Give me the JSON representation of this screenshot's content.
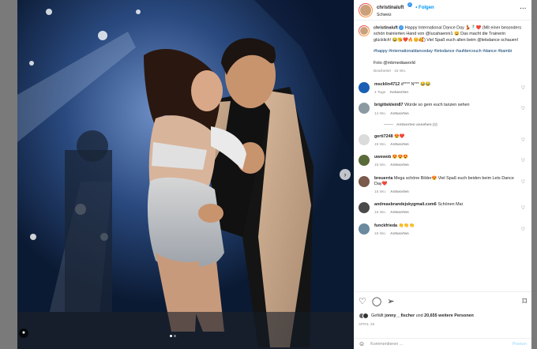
{
  "post": {
    "username": "christinaluft",
    "follow_label": "Folgen",
    "location": "Schweiz",
    "more_icon": "more-horizontal-icon",
    "carousel_dots": 2,
    "carousel_active": 1
  },
  "caption": {
    "username": "christinaluft",
    "text": "Happy International Dance Day 💃🕺❤️ (Mit einer besonders schön trainierten Hand von @lucahaenni1 😄 Das macht die Trainerin glücklich! 😂😘❤️🔥😊🥰) Viel Spaß euch allen beim @letsdance schauen!",
    "hashtags": "#happy #internationaldanceday #letsdance #aufdercouch #dance #bambi",
    "credit": "Foto @mbmediaworld",
    "edited": "Bearbeitet · 15 Wo."
  },
  "comments": [
    {
      "username": "mscklin4712",
      "text": "d**** N*** 😂😂",
      "age": "4 Tage",
      "reply": "Antworten",
      "avatar_color": "#1a5fb4"
    },
    {
      "username": "brigittekleín87",
      "text": "Würde so gern euch tanzen sehen",
      "age": "14 Wo.",
      "reply": "Antworten",
      "avatar_color": "#8a9aa0",
      "view_replies": "Antworten ansehen (1)"
    },
    {
      "username": "gerti7248",
      "text": "😍❤️",
      "age": "15 Wo.",
      "reply": "Antworten",
      "avatar_color": "#dbdbdb"
    },
    {
      "username": "uwewob",
      "text": "😍😍😍",
      "age": "15 Wo.",
      "reply": "Antworten",
      "avatar_color": "#5a6b3a"
    },
    {
      "username": "breuerria",
      "text": "Mega schöne Bilder😍 Viel Spaß euch beiden beim Lets Dance Day❤️",
      "age": "15 Wo.",
      "reply": "Antworten",
      "avatar_color": "#7a5a4a"
    },
    {
      "username": "andreasbrandejskygmail.com6",
      "text": "Schönen Mai",
      "age": "15 Wo.",
      "reply": "Antworten",
      "avatar_color": "#4a4a4a"
    },
    {
      "username": "funckfrieda",
      "text": "👏👏👏",
      "age": "15 Wo.",
      "reply": "Antworten",
      "avatar_color": "#6a8aa0"
    }
  ],
  "actions": {
    "like_icon": "heart-icon",
    "comment_icon": "comment-icon",
    "share_icon": "paper-plane-icon",
    "save_icon": "bookmark-icon",
    "likes_prefix": "Gefällt",
    "likes_user": "jonny__fischer",
    "likes_mid": "und",
    "likes_count": "20,655 weitere Personen",
    "date": "APRIL 29"
  },
  "add_comment": {
    "placeholder": "Kommentieren ...",
    "post_label": "Posten"
  }
}
